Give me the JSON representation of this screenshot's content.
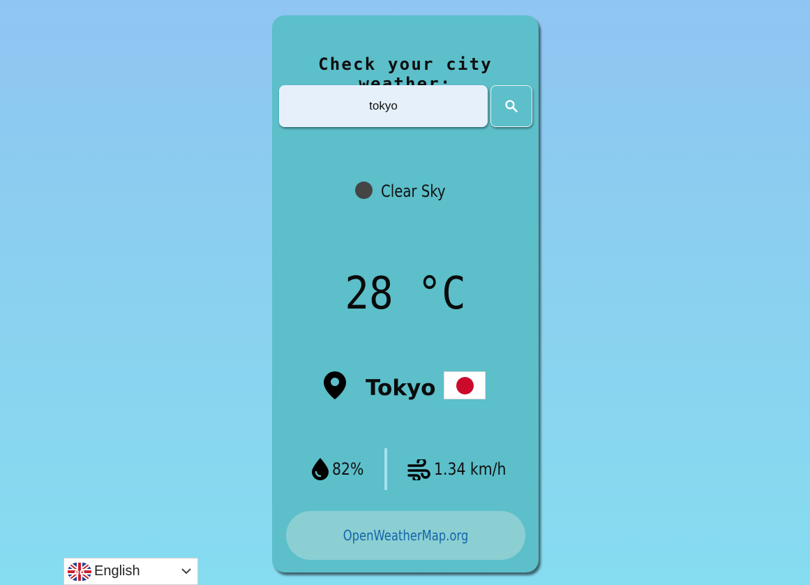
{
  "header": {
    "title": "Check your city weather:"
  },
  "search": {
    "value": "tokyo",
    "button_icon": "search-icon"
  },
  "weather": {
    "condition": "Clear Sky",
    "temperature": "28 °C",
    "city": "Tokyo",
    "country_flag": "japan-flag",
    "humidity": "82%",
    "wind": "1.34 km/h"
  },
  "footer": {
    "link": "OpenWeatherMap.org"
  },
  "language": {
    "selected": "English",
    "code": "en"
  },
  "colors": {
    "card": "#5cbfca",
    "input_bg": "#e6f0fb",
    "footer_bg": "#8bcfd3",
    "link": "#1565a8",
    "flag_red": "#cc0a2b"
  }
}
